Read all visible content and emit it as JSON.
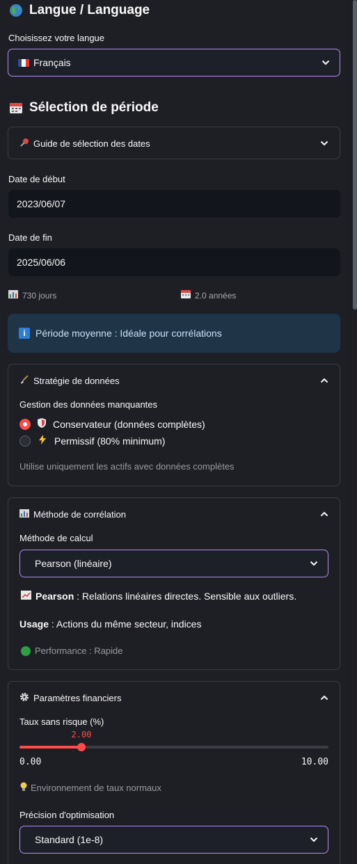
{
  "language": {
    "heading": "Langue / Language",
    "select_label": "Choisissez votre langue",
    "selected": "Français",
    "flag_icon": "french-flag-icon"
  },
  "period": {
    "heading": "Sélection de période",
    "guide_title": "Guide de sélection des dates",
    "start_label": "Date de début",
    "start_value": "2023/06/07",
    "end_label": "Date de fin",
    "end_value": "2025/06/06",
    "days": "730 jours",
    "years": "2.0 années",
    "info": "Période moyenne : Idéale pour corrélations"
  },
  "strategy": {
    "title": "Stratégie de données",
    "group_label": "Gestion des données manquantes",
    "options": [
      {
        "label": "Conservateur (données complètes)",
        "selected": true
      },
      {
        "label": "Permissif (80% minimum)",
        "selected": false
      }
    ],
    "caption": "Utilise uniquement les actifs avec données complètes"
  },
  "correlation": {
    "title": "Méthode de corrélation",
    "select_label": "Méthode de calcul",
    "selected": "Pearson (linéaire)",
    "desc_bold": "Pearson",
    "desc_rest": ": Relations linéaires directes. Sensible aux outliers.",
    "usage_bold": "Usage",
    "usage_rest": ": Actions du même secteur, indices",
    "performance": "Performance : Rapide"
  },
  "financial": {
    "title": "Paramètres financiers",
    "slider_label": "Taux sans risque (%)",
    "slider_value": "2.00",
    "slider_value_fraction": 0.2,
    "slider_min": "0.00",
    "slider_max": "10.00",
    "env_caption": "Environnement de taux normaux",
    "precision_label": "Précision d'optimisation",
    "precision_selected": "Standard (1e-8)"
  },
  "colors": {
    "accent": "#ff4b4b",
    "select_border": "#b48cf2",
    "info_bg": "#1f3447"
  }
}
